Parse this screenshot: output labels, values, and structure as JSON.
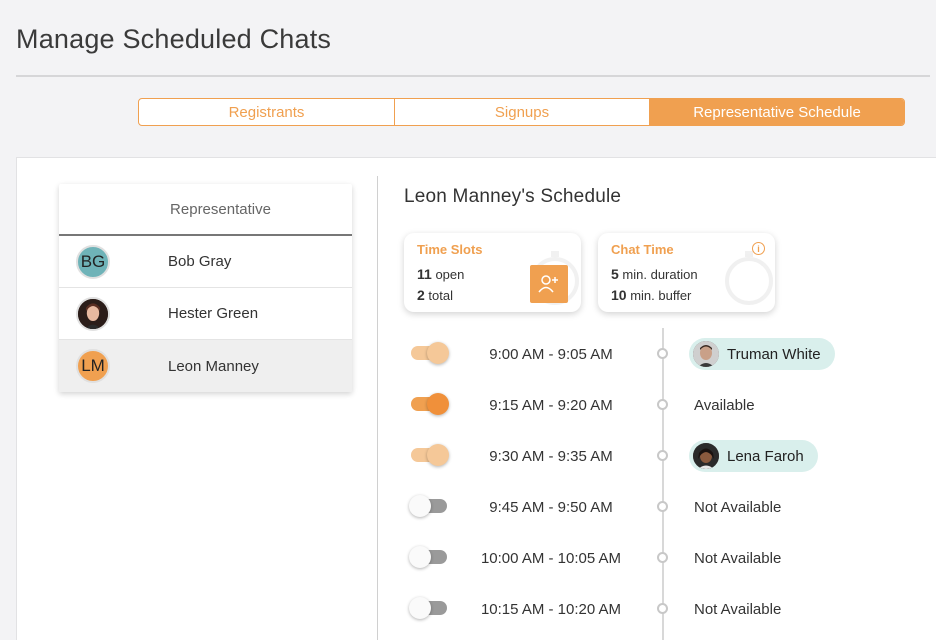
{
  "page": {
    "title": "Manage Scheduled Chats"
  },
  "tabs": [
    {
      "label": "Registrants",
      "active": false
    },
    {
      "label": "Signups",
      "active": false
    },
    {
      "label": "Representative Schedule",
      "active": true
    }
  ],
  "representatives": {
    "header": "Representative",
    "items": [
      {
        "initials": "BG",
        "name": "Bob Gray",
        "avatar_color": "#6fb3b8",
        "selected": false
      },
      {
        "initials": "",
        "name": "Hester Green",
        "avatar": "photo",
        "selected": false
      },
      {
        "initials": "LM",
        "name": "Leon Manney",
        "avatar_color": "#f0a050",
        "selected": true
      }
    ]
  },
  "schedule": {
    "title": "Leon Manney's Schedule",
    "time_slots": {
      "title": "Time Slots",
      "open_count": "11",
      "open_label": "open",
      "total_count": "2",
      "total_label": "total"
    },
    "chat_time": {
      "title": "Chat Time",
      "duration_value": "5",
      "duration_label": "min. duration",
      "buffer_value": "10",
      "buffer_label": "min. buffer"
    },
    "slots": [
      {
        "time": "9:00 AM - 9:05 AM",
        "enabled": true,
        "status": "Truman White",
        "booked": true
      },
      {
        "time": "9:15 AM - 9:20 AM",
        "enabled": true,
        "status": "Available",
        "booked": false
      },
      {
        "time": "9:30 AM - 9:35 AM",
        "enabled": true,
        "status": "Lena Faroh",
        "booked": true
      },
      {
        "time": "9:45 AM - 9:50 AM",
        "enabled": false,
        "status": "Not Available",
        "booked": false
      },
      {
        "time": "10:00 AM - 10:05 AM",
        "enabled": false,
        "status": "Not Available",
        "booked": false
      },
      {
        "time": "10:15 AM - 10:20 AM",
        "enabled": false,
        "status": "Not Available",
        "booked": false
      }
    ]
  },
  "colors": {
    "accent": "#f0a050",
    "pill_bg": "#d9efec"
  }
}
